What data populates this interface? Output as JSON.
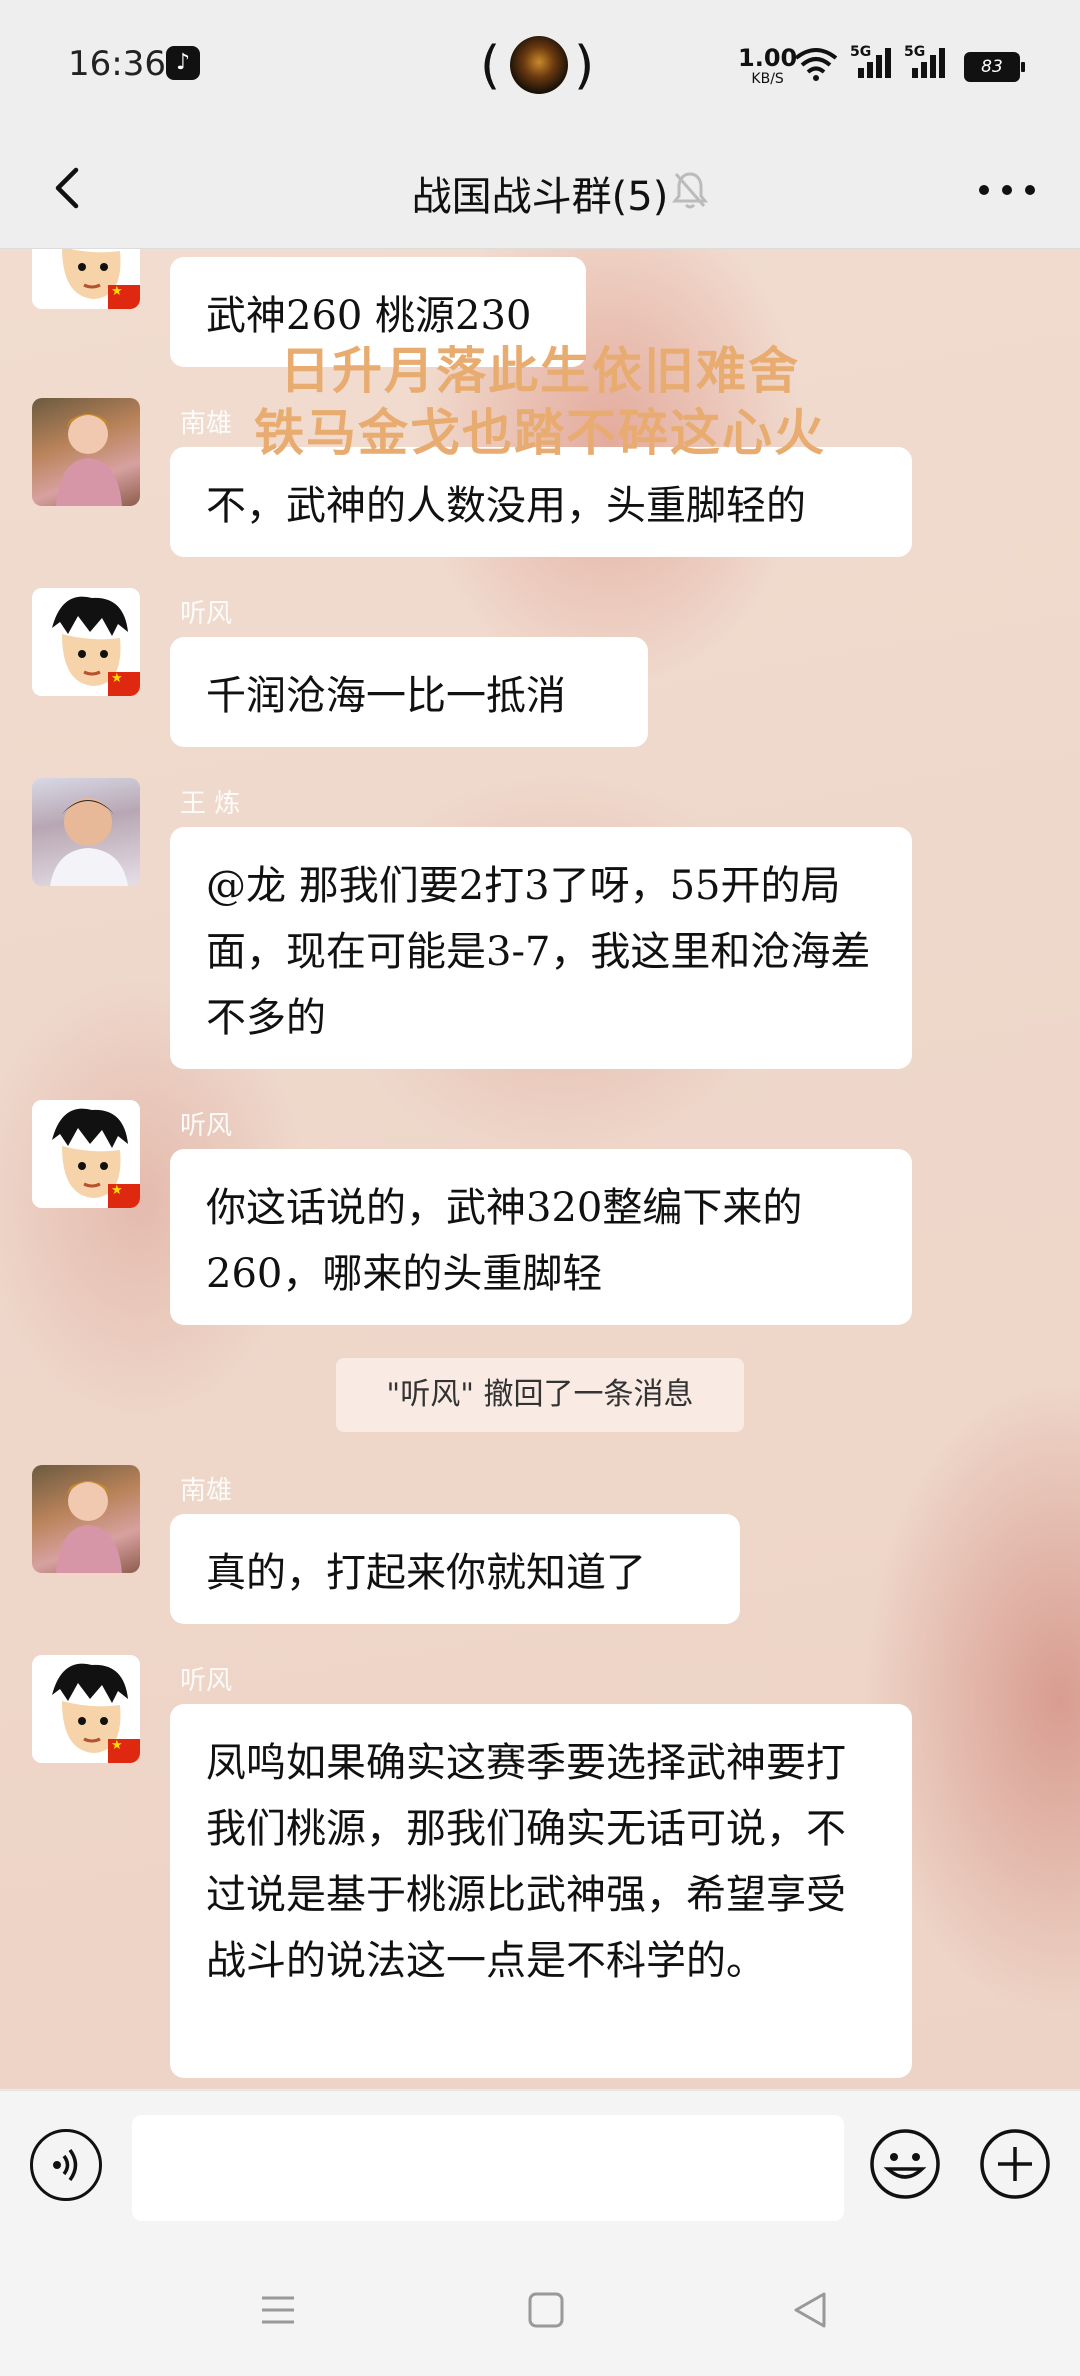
{
  "status_bar": {
    "time": "16:36",
    "app_icon": "tiktok-icon",
    "net_speed": "1.00",
    "net_unit": "KB/S",
    "sig1_label": "5G",
    "sig2_label": "5G",
    "battery": "83"
  },
  "header": {
    "title": "战国战斗群(5)",
    "back_icon": "chevron-left-icon",
    "mute_icon": "bell-muted-icon",
    "more_icon": "more-dots-icon"
  },
  "watermark": {
    "line1": "日升月落此生依旧难舍",
    "line2": "铁马金戈也踏不碎这心火"
  },
  "messages": [
    {
      "sender": "",
      "text": "武神260 桃源230"
    },
    {
      "sender": "南雄",
      "text": "不，武神的人数没用，头重脚轻的"
    },
    {
      "sender": "听风",
      "text": "千润沧海一比一抵消"
    },
    {
      "sender": "王  炼",
      "text": "@龙 那我们要2打3了呀，55开的局面，现在可能是3-7，我这里和沧海差不多的"
    },
    {
      "sender": "听风",
      "text": "你这话说的，武神320整编下来的260，哪来的头重脚轻"
    },
    {
      "sender": "南雄",
      "text": "真的，打起来你就知道了"
    },
    {
      "sender": "听风",
      "text": "凤鸣如果确实这赛季要选择武神要打我们桃源，那我们确实无话可说，不过说是基于桃源比武神强，希望享受战斗的说法这一点是不科学的。"
    }
  ],
  "system_notice": "\"听风\" 撤回了一条消息",
  "input_bar": {
    "placeholder": "",
    "voice_icon": "voice-icon",
    "emoji_icon": "emoji-icon",
    "plus_icon": "plus-icon"
  },
  "nav_bar": {
    "menu_icon": "menu-icon",
    "home_icon": "home-square-icon",
    "back_icon": "back-triangle-icon"
  }
}
